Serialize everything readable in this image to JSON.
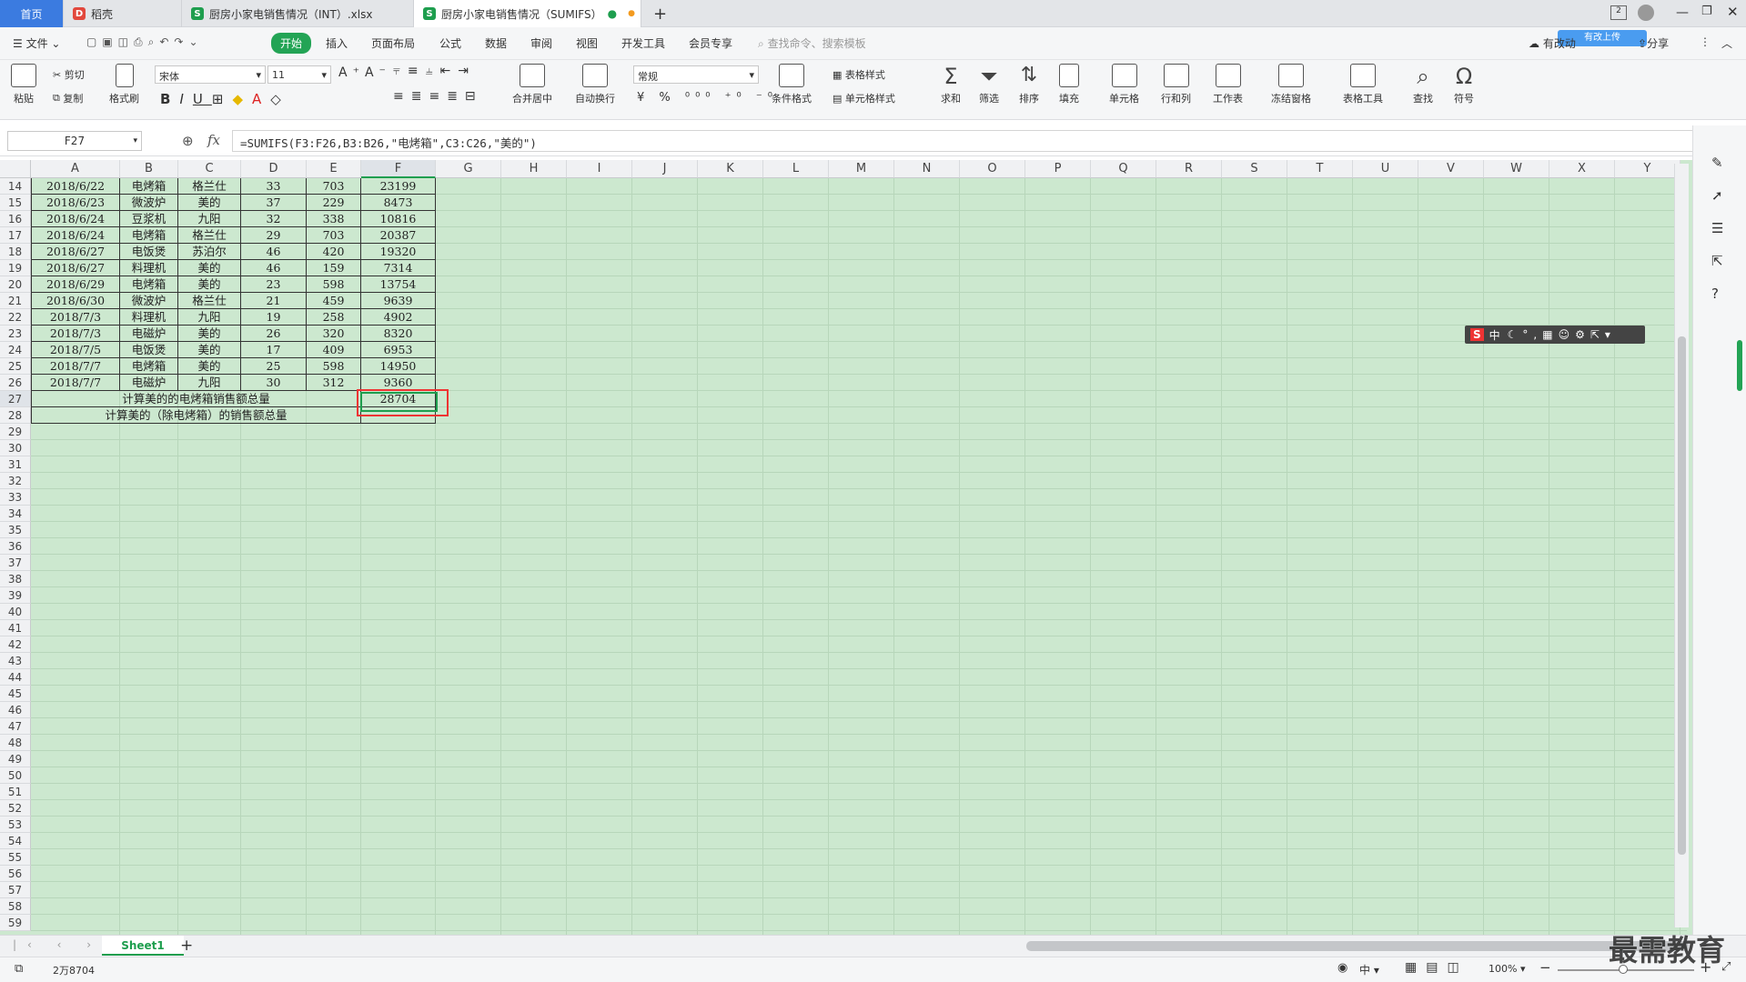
{
  "tabs": [
    {
      "label": "首页",
      "active": true
    },
    {
      "label": "稻壳"
    },
    {
      "label": "厨房小家电销售情况（INT）.xlsx"
    },
    {
      "label": "厨房小家电销售情况（SUMIFS）"
    }
  ],
  "menu": {
    "file": "文件",
    "items": [
      "开始",
      "插入",
      "页面布局",
      "公式",
      "数据",
      "审阅",
      "视图",
      "开发工具",
      "会员专享"
    ],
    "search": "查找命令、搜索模板",
    "sync": "有改动",
    "share": "分享",
    "share_badge": "有改上传"
  },
  "ribbon": {
    "paste": "粘贴",
    "cut": "剪切",
    "copy": "复制",
    "format_painter": "格式刷",
    "font": "宋体",
    "size": "11",
    "merge": "合并居中",
    "wrap": "自动换行",
    "numfmt": "常规",
    "cond": "条件格式",
    "table_style": "表格样式",
    "cell_style": "单元格样式",
    "sum": "求和",
    "filter": "筛选",
    "sort": "排序",
    "fill": "填充",
    "cells": "单元格",
    "rowcol": "行和列",
    "sheet": "工作表",
    "freeze": "冻结窗格",
    "tools": "表格工具",
    "find": "查找",
    "symbol": "符号"
  },
  "formula_bar": {
    "cell_ref": "F27",
    "fx": "fx",
    "formula": "=SUMIFS(F3:F26,B3:B26,\"电烤箱\",C3:C26,\"美的\")"
  },
  "columns": [
    "A",
    "B",
    "C",
    "D",
    "E",
    "F",
    "G",
    "H",
    "I",
    "J",
    "K",
    "L",
    "M",
    "N",
    "O",
    "P",
    "Q",
    "R",
    "S",
    "T",
    "U",
    "V",
    "W",
    "X",
    "Y"
  ],
  "rows": [
    {
      "n": "14",
      "date": "2018/6/22",
      "product": "电烤箱",
      "brand": "格兰仕",
      "qty": "33",
      "price": "703",
      "amount": "23199"
    },
    {
      "n": "15",
      "date": "2018/6/23",
      "product": "微波炉",
      "brand": "美的",
      "qty": "37",
      "price": "229",
      "amount": "8473"
    },
    {
      "n": "16",
      "date": "2018/6/24",
      "product": "豆浆机",
      "brand": "九阳",
      "qty": "32",
      "price": "338",
      "amount": "10816"
    },
    {
      "n": "17",
      "date": "2018/6/24",
      "product": "电烤箱",
      "brand": "格兰仕",
      "qty": "29",
      "price": "703",
      "amount": "20387"
    },
    {
      "n": "18",
      "date": "2018/6/27",
      "product": "电饭煲",
      "brand": "苏泊尔",
      "qty": "46",
      "price": "420",
      "amount": "19320"
    },
    {
      "n": "19",
      "date": "2018/6/27",
      "product": "料理机",
      "brand": "美的",
      "qty": "46",
      "price": "159",
      "amount": "7314"
    },
    {
      "n": "20",
      "date": "2018/6/29",
      "product": "电烤箱",
      "brand": "美的",
      "qty": "23",
      "price": "598",
      "amount": "13754"
    },
    {
      "n": "21",
      "date": "2018/6/30",
      "product": "微波炉",
      "brand": "格兰仕",
      "qty": "21",
      "price": "459",
      "amount": "9639"
    },
    {
      "n": "22",
      "date": "2018/7/3",
      "product": "料理机",
      "brand": "九阳",
      "qty": "19",
      "price": "258",
      "amount": "4902"
    },
    {
      "n": "23",
      "date": "2018/7/3",
      "product": "电磁炉",
      "brand": "美的",
      "qty": "26",
      "price": "320",
      "amount": "8320"
    },
    {
      "n": "24",
      "date": "2018/7/5",
      "product": "电饭煲",
      "brand": "美的",
      "qty": "17",
      "price": "409",
      "amount": "6953"
    },
    {
      "n": "25",
      "date": "2018/7/7",
      "product": "电烤箱",
      "brand": "美的",
      "qty": "25",
      "price": "598",
      "amount": "14950"
    },
    {
      "n": "26",
      "date": "2018/7/7",
      "product": "电磁炉",
      "brand": "九阳",
      "qty": "30",
      "price": "312",
      "amount": "9360"
    }
  ],
  "summary": [
    {
      "n": "27",
      "label": "计算美的的电烤箱销售额总量",
      "value": "28704"
    },
    {
      "n": "28",
      "label": "计算美的（除电烤箱）的销售额总量",
      "value": ""
    }
  ],
  "empty_rows": [
    "29",
    "30",
    "31",
    "32",
    "33",
    "34",
    "35",
    "36",
    "37",
    "38",
    "39",
    "40",
    "41",
    "42",
    "43",
    "44",
    "45",
    "46",
    "47",
    "48",
    "49",
    "50",
    "51",
    "52",
    "53",
    "54",
    "55",
    "56",
    "57",
    "58",
    "59"
  ],
  "sheet_tab": "Sheet1",
  "status": {
    "value": "2万8704",
    "zoom": "100%",
    "ime": "中"
  },
  "watermark": "最需教育",
  "ime_bar": "中"
}
